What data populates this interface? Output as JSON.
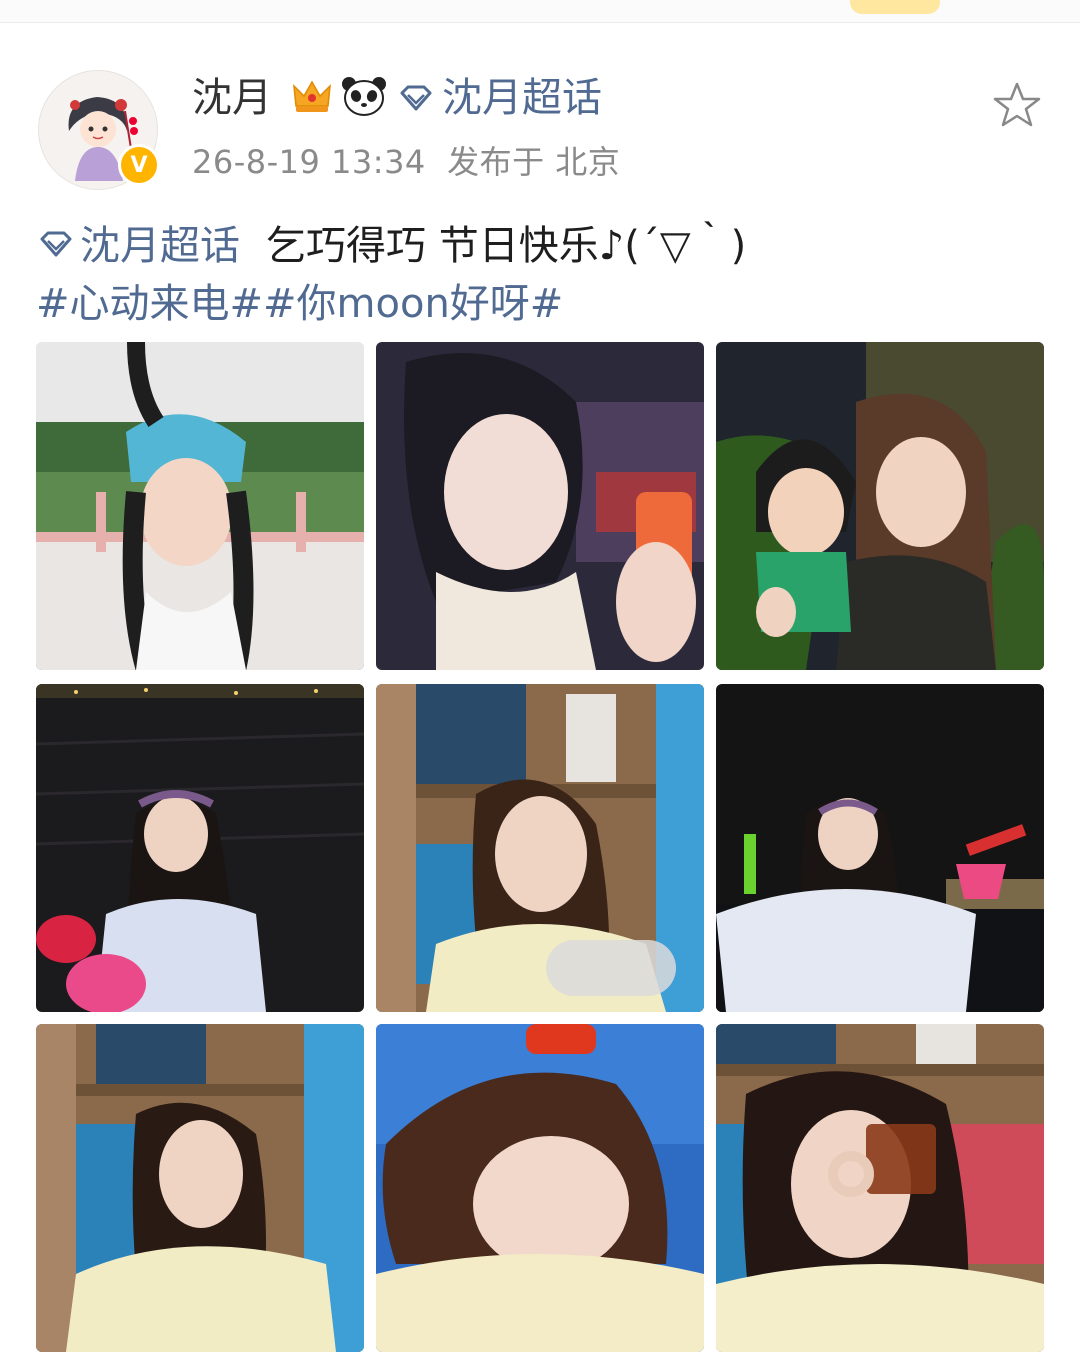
{
  "header": {
    "username": "沈月",
    "super_topic": "沈月超话",
    "timestamp": "26-8-19 13:34",
    "location": "发布于 北京",
    "verified_badge": "V"
  },
  "icons": {
    "crown": "crown-icon",
    "panda": "panda-icon",
    "diamond": "diamond-icon",
    "favorite": "star-icon"
  },
  "post": {
    "topic_tag": "沈月超话",
    "text": "乞巧得巧 节日快乐♪(´▽｀)",
    "hashtags": "#心动来电##你moon好呀#"
  },
  "colors": {
    "link": "#506a92",
    "badge": "#ffb400",
    "crown": "#f5a623"
  },
  "photos": [
    {
      "label": "photo-1"
    },
    {
      "label": "photo-2"
    },
    {
      "label": "photo-3"
    },
    {
      "label": "photo-4"
    },
    {
      "label": "photo-5"
    },
    {
      "label": "photo-6"
    },
    {
      "label": "photo-7"
    },
    {
      "label": "photo-8"
    },
    {
      "label": "photo-9"
    }
  ]
}
